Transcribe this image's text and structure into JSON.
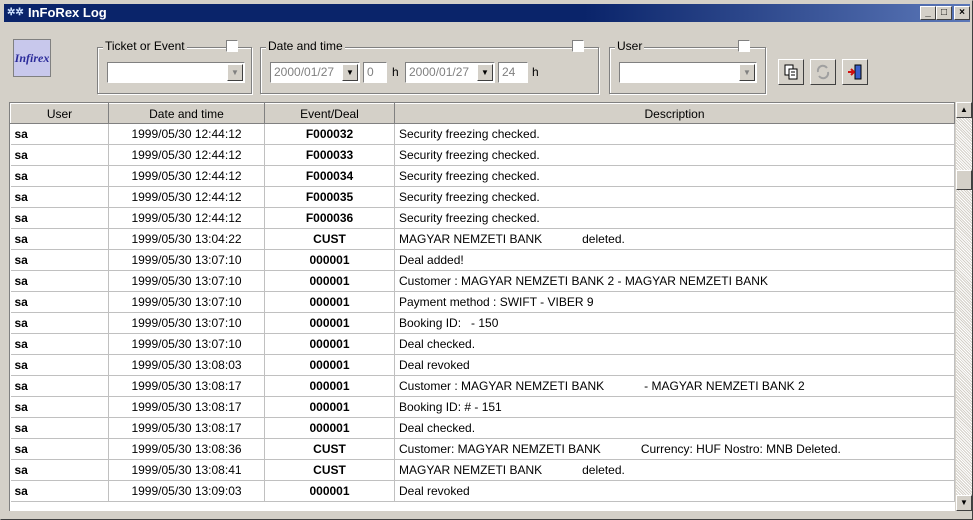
{
  "window": {
    "title": "InFoRex Log",
    "logo_text": "Infirex"
  },
  "filters": {
    "ticket_label": "Ticket or Event",
    "datetime_label": "Date and time",
    "user_label": "User",
    "date_from": "2000/01/27",
    "hour_from": "0",
    "date_to": "2000/01/27",
    "hour_to": "24",
    "h_unit": "h"
  },
  "toolbar": {
    "copy_icon": "copy-icon",
    "refresh_icon": "refresh-icon",
    "exit_icon": "exit-door-icon"
  },
  "table": {
    "headers": {
      "user": "User",
      "datetime": "Date and time",
      "event": "Event/Deal",
      "description": "Description"
    },
    "rows": [
      {
        "user": "sa",
        "datetime": "1999/05/30 12:44:12",
        "event": "F000032",
        "description": "Security freezing checked."
      },
      {
        "user": "sa",
        "datetime": "1999/05/30 12:44:12",
        "event": "F000033",
        "description": "Security freezing checked."
      },
      {
        "user": "sa",
        "datetime": "1999/05/30 12:44:12",
        "event": "F000034",
        "description": "Security freezing checked."
      },
      {
        "user": "sa",
        "datetime": "1999/05/30 12:44:12",
        "event": "F000035",
        "description": "Security freezing checked."
      },
      {
        "user": "sa",
        "datetime": "1999/05/30 12:44:12",
        "event": "F000036",
        "description": "Security freezing checked."
      },
      {
        "user": "sa",
        "datetime": "1999/05/30 13:04:22",
        "event": "CUST",
        "description": "MAGYAR NEMZETI BANK            deleted."
      },
      {
        "user": "sa",
        "datetime": "1999/05/30 13:07:10",
        "event": "000001",
        "description": "Deal added!"
      },
      {
        "user": "sa",
        "datetime": "1999/05/30 13:07:10",
        "event": "000001",
        "description": "Customer : MAGYAR NEMZETI BANK 2 - MAGYAR NEMZETI BANK"
      },
      {
        "user": "sa",
        "datetime": "1999/05/30 13:07:10",
        "event": "000001",
        "description": "Payment method : SWIFT - VIBER 9"
      },
      {
        "user": "sa",
        "datetime": "1999/05/30 13:07:10",
        "event": "000001",
        "description": "Booking ID:   - 150"
      },
      {
        "user": "sa",
        "datetime": "1999/05/30 13:07:10",
        "event": "000001",
        "description": "Deal checked."
      },
      {
        "user": "sa",
        "datetime": "1999/05/30 13:08:03",
        "event": "000001",
        "description": "Deal revoked"
      },
      {
        "user": "sa",
        "datetime": "1999/05/30 13:08:17",
        "event": "000001",
        "description": "Customer : MAGYAR NEMZETI BANK            - MAGYAR NEMZETI BANK 2"
      },
      {
        "user": "sa",
        "datetime": "1999/05/30 13:08:17",
        "event": "000001",
        "description": "Booking ID: # - 151"
      },
      {
        "user": "sa",
        "datetime": "1999/05/30 13:08:17",
        "event": "000001",
        "description": "Deal checked."
      },
      {
        "user": "sa",
        "datetime": "1999/05/30 13:08:36",
        "event": "CUST",
        "description": "Customer: MAGYAR NEMZETI BANK            Currency: HUF Nostro: MNB Deleted."
      },
      {
        "user": "sa",
        "datetime": "1999/05/30 13:08:41",
        "event": "CUST",
        "description": "MAGYAR NEMZETI BANK            deleted."
      },
      {
        "user": "sa",
        "datetime": "1999/05/30 13:09:03",
        "event": "000001",
        "description": "Deal revoked"
      }
    ]
  }
}
